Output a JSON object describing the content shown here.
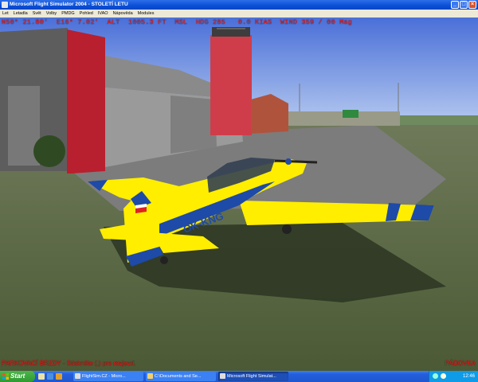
{
  "window": {
    "title": "Microsoft Flight Simulator 2004 - STOLETÍ LETU"
  },
  "menu": [
    "Let",
    "Letadla",
    "Svět",
    "Volby",
    "PMDG",
    "Pohled",
    "IVAO",
    "Nápověda",
    "Modules"
  ],
  "hud": {
    "status": "N50° 21.80'  E16° 7.02'  ALT  1005.3 FT  MSL  HDG 285   0.0 KIAS  WIND 359 / 00 Mag"
  },
  "aircraft": {
    "registration": "OK-KNG"
  },
  "messages": {
    "left": "PARKOVACÍ BRZDY - Stiskněte (.) pro rozjezd.",
    "right": "PÁDOVKA"
  },
  "taskbar": {
    "start_label": "Start",
    "tasks": [
      {
        "label": "FlightSim.CZ - Micro..."
      },
      {
        "label": "C:\\Documents and Se..."
      },
      {
        "label": "Microsoft Flight Simulat..."
      }
    ],
    "clock": "12:46"
  },
  "colors": {
    "hud_text": "#ff2020",
    "aircraft_body": "#ffee00",
    "aircraft_stripe": "#1e4aa8"
  }
}
